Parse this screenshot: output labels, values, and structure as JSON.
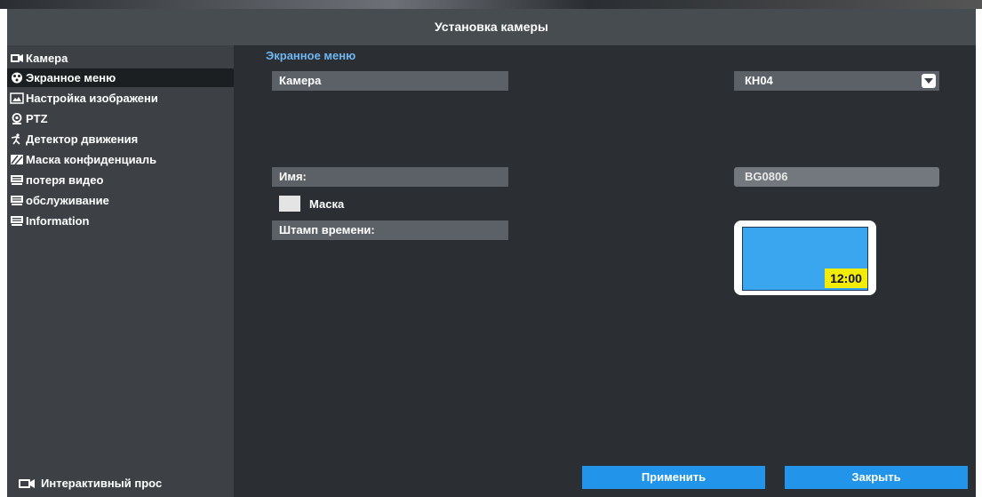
{
  "window": {
    "title": "Установка камеры"
  },
  "sidebar": {
    "items": [
      {
        "label": "Камера",
        "icon": "camera-icon"
      },
      {
        "label": "Экранное меню",
        "icon": "osd-icon",
        "active": true
      },
      {
        "label": "Настройка изображени",
        "icon": "image-icon"
      },
      {
        "label": "PTZ",
        "icon": "ptz-icon"
      },
      {
        "label": "Детектор движения",
        "icon": "motion-icon"
      },
      {
        "label": "Маска конфиденциаль",
        "icon": "privacy-mask-icon"
      },
      {
        "label": "потеря видео",
        "icon": "monitor-icon"
      },
      {
        "label": "обслуживание",
        "icon": "monitor-icon"
      },
      {
        "label": "Information",
        "icon": "monitor-icon"
      }
    ],
    "live_view_label": "Интерактивный прос",
    "live_view_icon": "camera-icon"
  },
  "main": {
    "section_title": "Экранное меню",
    "camera_label": "Камера",
    "camera_value": "КН04",
    "name_label": "Имя:",
    "name_value": "BG0806",
    "mask_label": "Маска",
    "mask_checked": false,
    "timestamp_label": "Штамп времени:",
    "preview_time": "12:00"
  },
  "buttons": {
    "apply": "Применить",
    "close": "Закрыть"
  },
  "colors": {
    "accent": "#2295ea",
    "section_title": "#6fb6f2",
    "preview_bg": "#3aa6f0",
    "timestamp_bg": "#f2ec07"
  }
}
